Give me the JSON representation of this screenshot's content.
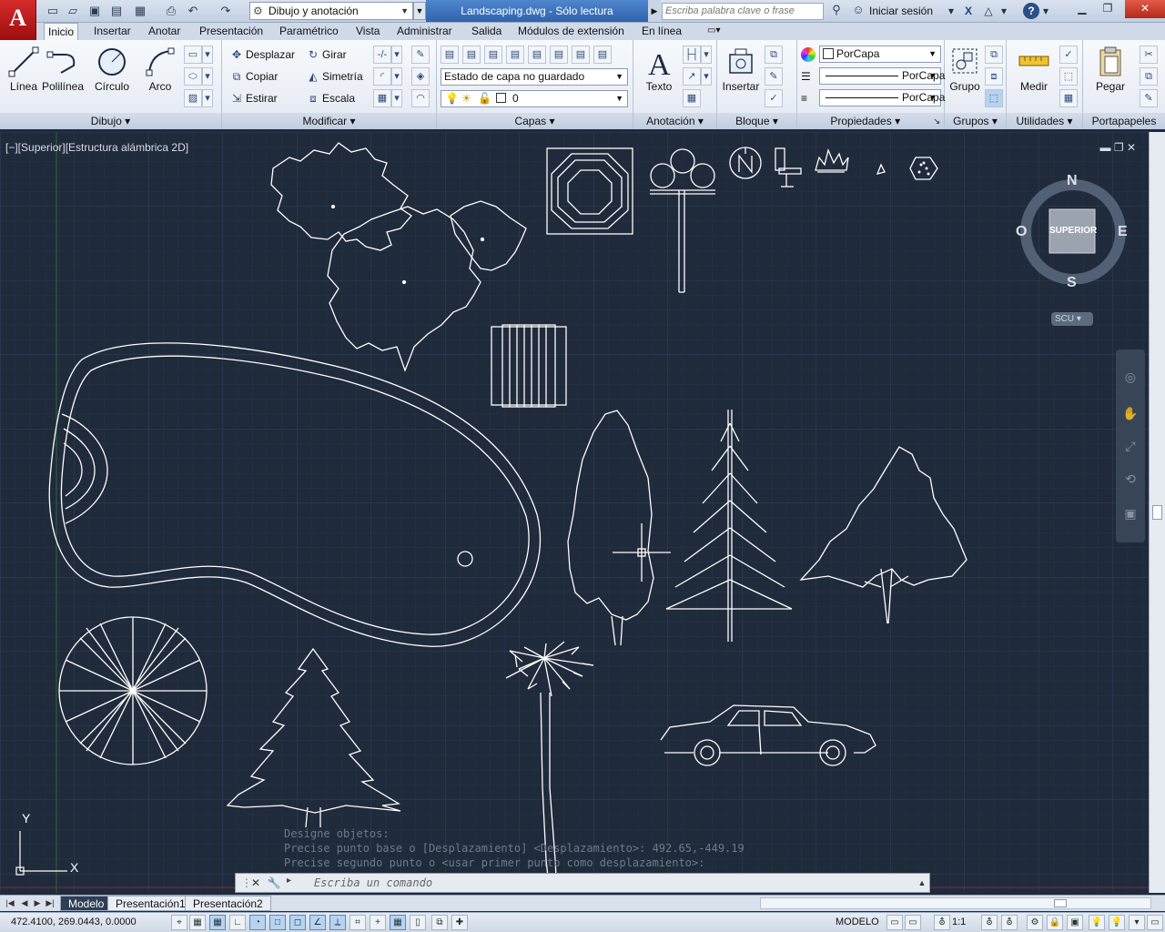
{
  "titlebar": {
    "logo": "A",
    "workspace": "Dibujo y anotación",
    "document_title": "Landscaping.dwg - Sólo lectura",
    "search_placeholder": "Escriba palabra clave o frase",
    "signin": "Iniciar sesión",
    "help": "?"
  },
  "ribbon_tabs": [
    "Inicio",
    "Insertar",
    "Anotar",
    "Presentación",
    "Paramétrico",
    "Vista",
    "Administrar",
    "Salida",
    "Módulos de extensión",
    "En línea"
  ],
  "ribbon": {
    "draw": {
      "title": "Dibujo",
      "linea": "Línea",
      "polilinea": "Polilínea",
      "circulo": "Círculo",
      "arco": "Arco"
    },
    "modify": {
      "title": "Modificar",
      "desplazar": "Desplazar",
      "girar": "Girar",
      "copiar": "Copiar",
      "simetria": "Simetría",
      "estirar": "Estirar",
      "escala": "Escala"
    },
    "layers": {
      "title": "Capas",
      "state": "Estado de capa no guardado",
      "current_layer": "0"
    },
    "annotation": {
      "title": "Anotación",
      "texto": "Texto"
    },
    "block": {
      "title": "Bloque",
      "insertar": "Insertar"
    },
    "properties": {
      "title": "Propiedades",
      "color": "PorCapa",
      "linetype": "PorCapa",
      "lineweight": "PorCapa"
    },
    "groups": {
      "title": "Grupos",
      "grupo": "Grupo"
    },
    "utilities": {
      "title": "Utilidades",
      "medir": "Medir"
    },
    "clipboard": {
      "title": "Portapapeles",
      "pegar": "Pegar"
    }
  },
  "viewport": {
    "label": "[−][Superior][Estructura alámbrica 2D]",
    "controls": "▬ ❐ ✕"
  },
  "viewcube": {
    "face": "SUPERIOR",
    "north": "N",
    "south": "S",
    "east": "E",
    "west": "O",
    "ucs": "SCU"
  },
  "ucs_icon": {
    "x": "X",
    "y": "Y"
  },
  "command": {
    "history": [
      "Designe objetos:",
      "Precise punto base o [Desplazamiento] <Desplazamiento>: 492.65,-449.19",
      "Precise segundo punto o <usar primer punto como desplazamiento>:"
    ],
    "placeholder": "Escriba un comando"
  },
  "layout_tabs": [
    "Modelo",
    "Presentación1",
    "Presentación2"
  ],
  "status": {
    "coordinates": "472.4100, 269.0443, 0.0000",
    "mode": "MODELO",
    "scale": "1:1"
  },
  "colors": {
    "canvas_bg": "#1f2a3a",
    "grid_minor": "#27334a",
    "grid_major": "#33405a",
    "drawing_lines": "#ffffff",
    "accent": "#2f63ad"
  }
}
